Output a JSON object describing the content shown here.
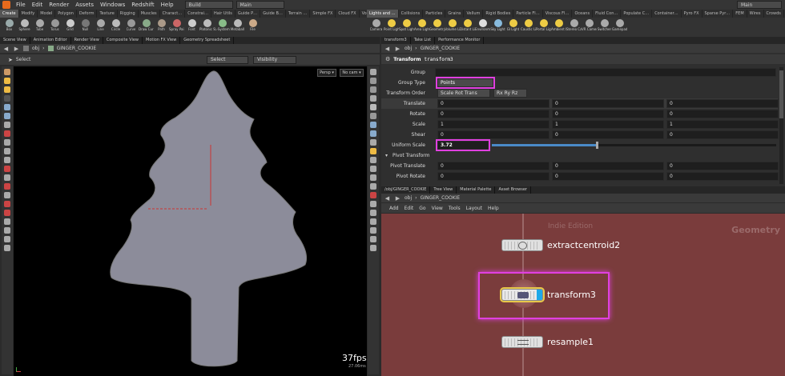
{
  "menubar": {
    "items": [
      "File",
      "Edit",
      "Render",
      "Assets",
      "Windows",
      "Redshift",
      "Help"
    ],
    "desktop1": "Build",
    "desktop2": "Main",
    "desktop3": "Main"
  },
  "shelf_left": {
    "tabs": [
      "Create",
      "Modify",
      "Model",
      "Polygon",
      "Deform",
      "Texture",
      "Rigging",
      "Muscles",
      "Charact…",
      "Constrai…",
      "Hair Utils",
      "Guide P…",
      "Guide B…",
      "Terrain …",
      "Simple FX",
      "Cloud FX",
      "Volume"
    ],
    "tools": [
      {
        "label": "Box",
        "color": "#9aa"
      },
      {
        "label": "Sphere",
        "color": "#bbb"
      },
      {
        "label": "Tube",
        "color": "#aaa"
      },
      {
        "label": "Torus",
        "color": "#999"
      },
      {
        "label": "Grid",
        "color": "#ccc"
      },
      {
        "label": "Null",
        "color": "#777"
      },
      {
        "label": "Line",
        "color": "#aaa"
      },
      {
        "label": "Circle",
        "color": "#bbb"
      },
      {
        "label": "Curve",
        "color": "#999"
      },
      {
        "label": "Draw Curve",
        "color": "#8a8"
      },
      {
        "label": "Path",
        "color": "#a98"
      },
      {
        "label": "Spray Paint",
        "color": "#c66"
      },
      {
        "label": "Font",
        "color": "#ccc"
      },
      {
        "label": "Platonic Solids",
        "color": "#bbb"
      },
      {
        "label": "L-System",
        "color": "#8b8"
      },
      {
        "label": "Metaball",
        "color": "#bbb"
      },
      {
        "label": "File",
        "color": "#ca8"
      }
    ]
  },
  "shelf_right": {
    "tabs": [
      "Lights and …",
      "Collisions",
      "Particles",
      "Grains",
      "Vellum",
      "Rigid Bodies",
      "Particle Fl…",
      "Viscous Fl…",
      "Oceans",
      "Fluid Con…",
      "Populate C…",
      "Container…",
      "Pyro FX",
      "Sparse Pyr…",
      "FEM",
      "Wires",
      "Crowds",
      "Drive Sim…"
    ],
    "tools": [
      {
        "label": "Camera",
        "color": "#aaa"
      },
      {
        "label": "Point Light",
        "color": "#ec4"
      },
      {
        "label": "Spot Light",
        "color": "#ec4"
      },
      {
        "label": "Area Light",
        "color": "#ec4"
      },
      {
        "label": "Geometry Light",
        "color": "#ec4"
      },
      {
        "label": "Volume Light",
        "color": "#ec4"
      },
      {
        "label": "Distant Light",
        "color": "#ec4"
      },
      {
        "label": "Environment Light",
        "color": "#ddd"
      },
      {
        "label": "Sky Light",
        "color": "#8bd"
      },
      {
        "label": "GI Light",
        "color": "#ec4"
      },
      {
        "label": "Caustic Light",
        "color": "#ec4"
      },
      {
        "label": "Portal Light",
        "color": "#ec4"
      },
      {
        "label": "Ambient Light",
        "color": "#ec4"
      },
      {
        "label": "Stereo Camera",
        "color": "#aaa"
      },
      {
        "label": "VR Camera",
        "color": "#aaa"
      },
      {
        "label": "Switcher",
        "color": "#aaa"
      },
      {
        "label": "Gamepad Camera",
        "color": "#aaa"
      }
    ]
  },
  "viewport": {
    "tabs": [
      "Scene View",
      "Animation Editor",
      "Render View",
      "Composite View",
      "Motion FX View",
      "Geometry Spreadsheet"
    ],
    "path_obj": "obj",
    "path_node": "GINGER_COOKIE",
    "select_label": "Select",
    "select_dropdown": "Select",
    "visibility_dropdown": "Visibility",
    "persp_btn": "Persp ▾",
    "cam_btn": "No cam ▾",
    "fps": "37fps",
    "fps_sub": "27.06ms"
  },
  "params": {
    "tabs": [
      "transform3",
      "Take List",
      "Performance Monitor"
    ],
    "path_obj": "obj",
    "path_node": "GINGER_COOKIE",
    "node_type": "Transform",
    "node_name": "transform3",
    "group_label": "Group",
    "group_type_label": "Group Type",
    "group_type_value": "Points",
    "transform_order_label": "Transform Order",
    "transform_order_value": "Scale Rot Trans",
    "rot_order_value": "Rx Ry Rz",
    "rows": [
      {
        "label": "Translate",
        "v": [
          "0",
          "0",
          "0"
        ]
      },
      {
        "label": "Rotate",
        "v": [
          "0",
          "0",
          "0"
        ]
      },
      {
        "label": "Scale",
        "v": [
          "1",
          "1",
          "1"
        ]
      },
      {
        "label": "Shear",
        "v": [
          "0",
          "0",
          "0"
        ]
      }
    ],
    "uniform_scale_label": "Uniform Scale",
    "uniform_scale_value": "3.72",
    "uniform_scale_fraction": 0.37,
    "pivot_section": "Pivot Transform",
    "pivot_rows": [
      {
        "label": "Pivot Translate",
        "v": [
          "0",
          "0",
          "0"
        ]
      },
      {
        "label": "Pivot Rotate",
        "v": [
          "0",
          "0",
          "0"
        ]
      }
    ]
  },
  "network": {
    "tabs": [
      "/obj/GINGER_COOKIE",
      "Tree View",
      "Material Palette",
      "Asset Browser"
    ],
    "path_obj": "obj",
    "path_node": "GINGER_COOKIE",
    "menu": [
      "Add",
      "Edit",
      "Go",
      "View",
      "Tools",
      "Layout",
      "Help"
    ],
    "watermark": "Indie Edition",
    "context": "Geometry",
    "nodes": [
      "extractcentroid2",
      "transform3",
      "resample1"
    ]
  },
  "colors": {
    "network_bg": "#7a3c3c",
    "highlight": "#e040e0",
    "tree": "#8c8c9a",
    "selected_node": "#1da8e8"
  }
}
